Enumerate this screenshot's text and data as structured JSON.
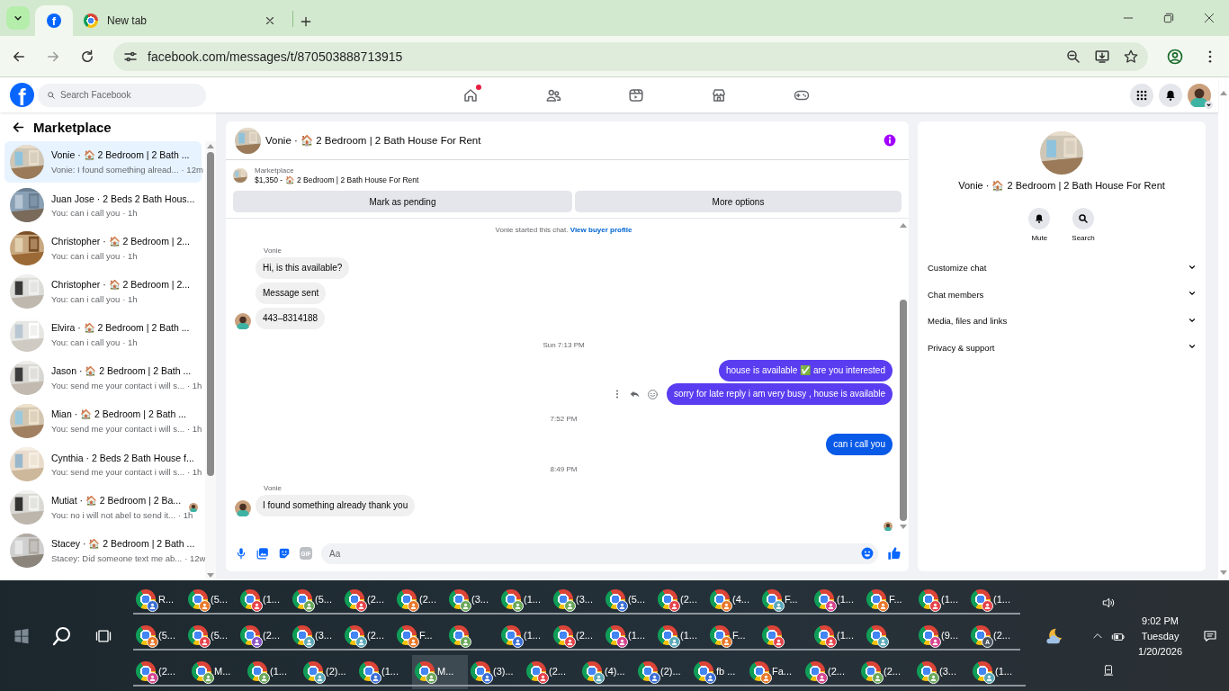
{
  "browser": {
    "tabs": [
      {
        "kind": "facebook",
        "icon_text": "f",
        "selected": true
      },
      {
        "kind": "page",
        "label": "New tab",
        "selected": false
      }
    ],
    "url": "facebook.com/messages/t/870503888713915"
  },
  "facebook": {
    "logo": "f",
    "search": {
      "placeholder": "Search Facebook"
    },
    "nav": [
      {
        "kind": "home",
        "dot": true
      },
      {
        "kind": "friends",
        "dot": false
      },
      {
        "kind": "video",
        "dot": false
      },
      {
        "kind": "marketplace",
        "dot": false
      },
      {
        "kind": "gaming",
        "dot": false
      }
    ]
  },
  "sidebar": {
    "title": "Marketplace",
    "conversations": [
      {
        "name": "Vonie · 🏠 2 Bedroom | 2 Bath ...",
        "preview": "Vonie: I found something alread...",
        "time": "· 12m",
        "selected": true,
        "seen": false
      },
      {
        "name": "Juan Jose · 2 Beds 2 Bath Hous...",
        "preview": "You: can i call you",
        "time": "· 1h",
        "selected": false,
        "seen": false
      },
      {
        "name": "Christopher · 🏠 2 Bedroom | 2...",
        "preview": "You: can i call you",
        "time": "· 1h",
        "selected": false,
        "seen": false
      },
      {
        "name": "Christopher · 🏠 2 Bedroom | 2...",
        "preview": "You: can i call you",
        "time": "· 1h",
        "selected": false,
        "seen": false
      },
      {
        "name": "Elvira · 🏠 2 Bedroom | 2 Bath ...",
        "preview": "You: can i call you",
        "time": "· 1h",
        "selected": false,
        "seen": false
      },
      {
        "name": "Jason · 🏠 2 Bedroom | 2 Bath ...",
        "preview": "You: send me your contact i will s...",
        "time": "· 1h",
        "selected": false,
        "seen": false
      },
      {
        "name": "Mian · 🏠 2 Bedroom | 2 Bath ...",
        "preview": "You: send me your contact i will s...",
        "time": "· 1h",
        "selected": false,
        "seen": false
      },
      {
        "name": "Cynthia · 2 Beds 2 Bath House f...",
        "preview": "You: send me your contact i will s...",
        "time": "· 1h",
        "selected": false,
        "seen": false
      },
      {
        "name": "Mutiat · 🏠 2 Bedroom | 2 Ba...",
        "preview": "You: no i will not abel to send it...",
        "time": "· 1h",
        "selected": false,
        "seen": true
      },
      {
        "name": "Stacey · 🏠 2 Bedroom | 2 Bath ...",
        "preview": "Stacey: Did someone text me ab...",
        "time": "· 12w",
        "selected": false,
        "seen": false
      }
    ]
  },
  "chat": {
    "title": "Vonie · 🏠 2 Bedroom | 2 Bath House For Rent",
    "listing": {
      "label": "Marketplace",
      "price_title": "$1,350 - 🏠 2 Bedroom | 2 Bath House For Rent"
    },
    "buttons": [
      "Mark as pending",
      "More options"
    ],
    "messages": [
      {
        "kind": "notice",
        "text": "Vonie started this chat.",
        "link": "View buyer profile"
      },
      {
        "kind": "sender",
        "text": "Vonie"
      },
      {
        "kind": "in",
        "text": "Hi, is this available?",
        "avatar": false
      },
      {
        "kind": "in",
        "text": "Message sent",
        "avatar": false
      },
      {
        "kind": "in",
        "text": "443–8314188",
        "avatar": true
      },
      {
        "kind": "time",
        "text": "Sun 7:13 PM"
      },
      {
        "kind": "out",
        "text": "house is available ✅ are you interested",
        "color": "#5a3df0",
        "actions": false
      },
      {
        "kind": "out",
        "text": "sorry for late reply i am very busy , house is available",
        "color": "#5a3df0",
        "actions": true
      },
      {
        "kind": "time",
        "text": "7:52 PM"
      },
      {
        "kind": "out",
        "text": "can i call you",
        "color": "#0a5ae8",
        "actions": false
      },
      {
        "kind": "time",
        "text": "8:49 PM"
      },
      {
        "kind": "sender",
        "text": "Vonie"
      },
      {
        "kind": "in",
        "text": "I found something already thank you",
        "avatar": true
      }
    ],
    "composer": {
      "gif_label": "GIF",
      "placeholder": "Aa"
    }
  },
  "details": {
    "title": "Vonie · 🏠 2 Bedroom | 2 Bath House For Rent",
    "actions": [
      {
        "kind": "mute",
        "label": "Mute"
      },
      {
        "kind": "search",
        "label": "Search"
      }
    ],
    "sections": [
      {
        "label": "Customize chat",
        "expanded": false
      },
      {
        "label": "Chat members",
        "expanded": false
      },
      {
        "label": "Media, files and links",
        "expanded": false
      },
      {
        "label": "Privacy & support",
        "expanded": false
      }
    ]
  },
  "taskbar": {
    "top_row": [
      {
        "label": "R...",
        "color": "#3b6fd6",
        "selected": false
      },
      {
        "label": "(5...",
        "color": "#e8782a",
        "selected": false
      },
      {
        "label": "(1...",
        "color": "#e5434b",
        "selected": false
      },
      {
        "label": "(5...",
        "color": "#6aa85a",
        "selected": false
      },
      {
        "label": "(2...",
        "color": "#e5434b",
        "selected": false
      },
      {
        "label": "(2...",
        "color": "#e8782a",
        "selected": false
      },
      {
        "label": "(3...",
        "color": "#6aa85a",
        "selected": false
      },
      {
        "label": "(1...",
        "color": "#6aa85a",
        "selected": false
      },
      {
        "label": "(3...",
        "color": "#6aa85a",
        "selected": false
      },
      {
        "label": "(5...",
        "color": "#3b6fd6",
        "selected": false
      },
      {
        "label": "(2...",
        "color": "#e5434b",
        "selected": false
      },
      {
        "label": "(4...",
        "color": "#e8782a",
        "selected": false
      },
      {
        "label": "F...",
        "color": "#5aa9b8",
        "selected": false
      },
      {
        "label": "(1...",
        "color": "#d6458f",
        "selected": false
      },
      {
        "label": "F...",
        "color": "#e8782a",
        "selected": false
      },
      {
        "label": "(1...",
        "color": "#e5434b",
        "selected": false
      },
      {
        "label": "(1...",
        "color": "#e5434b",
        "selected": false
      }
    ],
    "middle_row": [
      {
        "label": "(5...",
        "color": "#e8782a",
        "selected": false
      },
      {
        "label": "(5...",
        "color": "#e5434b",
        "selected": false
      },
      {
        "label": "(2...",
        "color": "#8a54c7",
        "selected": false
      },
      {
        "label": "(3...",
        "color": "#5aa9b8",
        "selected": false
      },
      {
        "label": "(2...",
        "color": "#5aa9b8",
        "selected": false
      },
      {
        "label": "F...",
        "color": "#e8782a",
        "selected": false
      },
      {
        "color": "#6aa85a",
        "selected": false
      },
      {
        "label": "(1...",
        "color": "#3b6fd6",
        "selected": false
      },
      {
        "label": "(2...",
        "color": "#e5434b",
        "selected": false
      },
      {
        "label": "(1...",
        "color": "#d6458f",
        "selected": false
      },
      {
        "label": "(1...",
        "color": "#5aa9b8",
        "selected": false
      },
      {
        "label": "F...",
        "color": "#e8782a",
        "selected": false
      },
      {
        "color": "#e5434b",
        "selected": false
      },
      {
        "label": "(1...",
        "color": "#e5434b",
        "selected": false
      },
      {
        "color": "#5aa9b8",
        "selected": false
      },
      {
        "label": "(9...",
        "color": "#d6458f",
        "selected": false
      },
      {
        "label": "(2...",
        "color": "#4a5560",
        "badge_text": "A",
        "selected": false
      }
    ],
    "bottom_row": [
      {
        "label": "(2...",
        "color": "#d6458f",
        "selected": false
      },
      {
        "label": "M...",
        "color": "#6aa85a",
        "selected": false
      },
      {
        "label": "(1...",
        "color": "#6aa85a",
        "selected": false
      },
      {
        "label": "(2)...",
        "color": "#5aa9b8",
        "selected": false
      },
      {
        "label": "(1...",
        "color": "#3b6fd6",
        "selected": false
      },
      {
        "label": "M...",
        "color": "#6aa85a",
        "selected": true
      },
      {
        "label": "(3)...",
        "color": "#3b6fd6",
        "selected": false
      },
      {
        "label": "(2...",
        "color": "#e5434b",
        "selected": false
      },
      {
        "label": "(4)...",
        "color": "#5aa9b8",
        "selected": false
      },
      {
        "label": "(2)...",
        "color": "#3b6fd6",
        "selected": false
      },
      {
        "label": "fb ...",
        "color": "#3b6fd6",
        "selected": false
      },
      {
        "label": "Fa...",
        "color": "#e8782a",
        "selected": false
      },
      {
        "label": "(2...",
        "color": "#d6458f",
        "selected": false
      },
      {
        "label": "(2...",
        "color": "#6aa85a",
        "selected": false
      },
      {
        "label": "(3...",
        "color": "#6aa85a",
        "selected": false
      },
      {
        "label": "(1...",
        "color": "#5aa9b8",
        "selected": false
      }
    ],
    "clock": {
      "time": "9:02 PM",
      "day": "Tuesday",
      "date": "1/20/2026"
    }
  }
}
